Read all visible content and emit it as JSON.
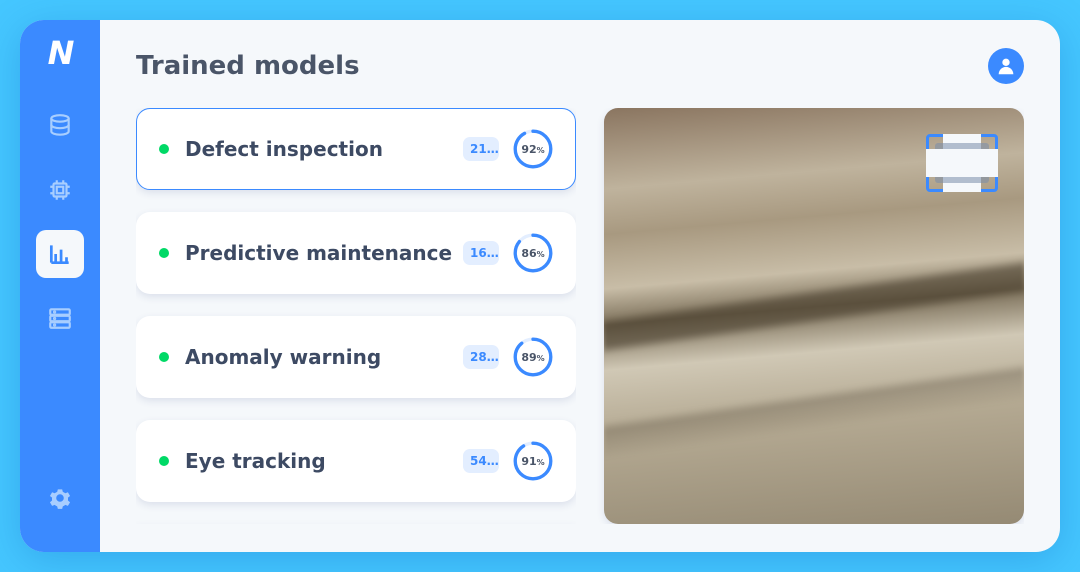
{
  "header": {
    "title": "Trained models"
  },
  "colors": {
    "accent": "#3b8aff",
    "status_ok": "#00d966"
  },
  "sidebar": {
    "logo": "N",
    "items": [
      {
        "name": "database",
        "active": false
      },
      {
        "name": "chip",
        "active": false
      },
      {
        "name": "chart",
        "active": true
      },
      {
        "name": "server",
        "active": false
      }
    ],
    "footer": {
      "name": "settings"
    }
  },
  "models": [
    {
      "name": "Defect inspection",
      "badge": "21…",
      "accuracy": 92,
      "selected": true
    },
    {
      "name": "Predictive maintenance",
      "badge": "16…",
      "accuracy": 86,
      "selected": false
    },
    {
      "name": "Anomaly warning",
      "badge": "28…",
      "accuracy": 89,
      "selected": false
    },
    {
      "name": "Eye tracking",
      "badge": "54…",
      "accuracy": 91,
      "selected": false
    }
  ],
  "preview": {
    "detection_icon": "defect-mark"
  }
}
